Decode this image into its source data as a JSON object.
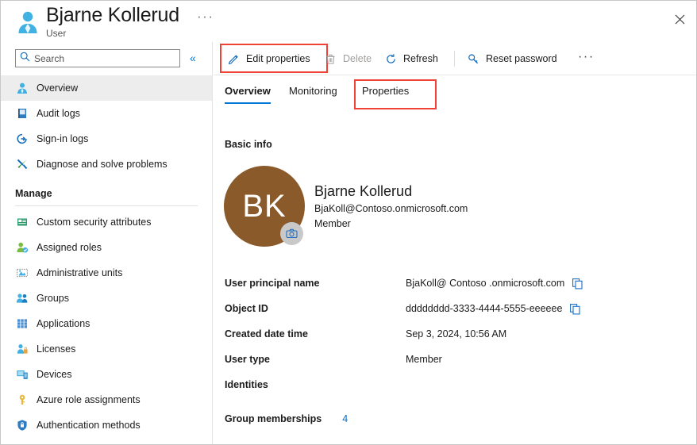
{
  "header": {
    "title": "Bjarne Kollerud",
    "subtitle": "User",
    "more_label": "···",
    "close_label": "✕"
  },
  "sidebar": {
    "search": {
      "placeholder": "Search",
      "value": ""
    },
    "collapse_label": "«",
    "items": [
      {
        "label": "Overview",
        "icon": "user-icon",
        "active": true
      },
      {
        "label": "Audit logs",
        "icon": "audit-log-icon",
        "active": false
      },
      {
        "label": "Sign-in logs",
        "icon": "sign-in-icon",
        "active": false
      },
      {
        "label": "Diagnose and solve problems",
        "icon": "wrench-icon",
        "active": false
      }
    ],
    "section_label": "Manage",
    "manage_items": [
      {
        "label": "Custom security attributes",
        "icon": "security-attribute-icon"
      },
      {
        "label": "Assigned roles",
        "icon": "assigned-roles-icon"
      },
      {
        "label": "Administrative units",
        "icon": "administrative-units-icon"
      },
      {
        "label": "Groups",
        "icon": "groups-icon"
      },
      {
        "label": "Applications",
        "icon": "applications-icon"
      },
      {
        "label": "Licenses",
        "icon": "licenses-icon"
      },
      {
        "label": "Devices",
        "icon": "devices-icon"
      },
      {
        "label": "Azure role assignments",
        "icon": "key-icon"
      },
      {
        "label": "Authentication methods",
        "icon": "shield-icon"
      }
    ]
  },
  "toolbar": {
    "edit_properties": "Edit properties",
    "delete": "Delete",
    "refresh": "Refresh",
    "reset_password": "Reset password",
    "more_label": "···"
  },
  "tabs": [
    {
      "label": "Overview",
      "active": true
    },
    {
      "label": "Monitoring",
      "active": false
    },
    {
      "label": "Properties",
      "active": false,
      "highlighted": true
    }
  ],
  "main": {
    "section_title": "Basic info",
    "profile": {
      "initials": "BK",
      "avatar_color": "#8a5a2b",
      "name": "Bjarne Kollerud",
      "email": "BjaKoll@Contoso.onmicrosoft.com",
      "member_type": "Member"
    },
    "properties": [
      {
        "label": "User principal name",
        "value": "BjaKoll@ Contoso .onmicrosoft.com",
        "copyable": true
      },
      {
        "label": "Object ID",
        "value": "dddddddd-3333-4444-5555-eeeeee",
        "copyable": true
      },
      {
        "label": "Created date time",
        "value": "Sep 3, 2024, 10:56 AM",
        "copyable": false
      },
      {
        "label": "User type",
        "value": "Member",
        "copyable": false
      },
      {
        "label": "Identities",
        "value": "",
        "copyable": false
      }
    ],
    "group_memberships": {
      "label": "Group memberships",
      "count": "4"
    }
  },
  "colors": {
    "accent": "#0078d4",
    "highlight": "#ef4136",
    "link": "#0f6cbd"
  }
}
